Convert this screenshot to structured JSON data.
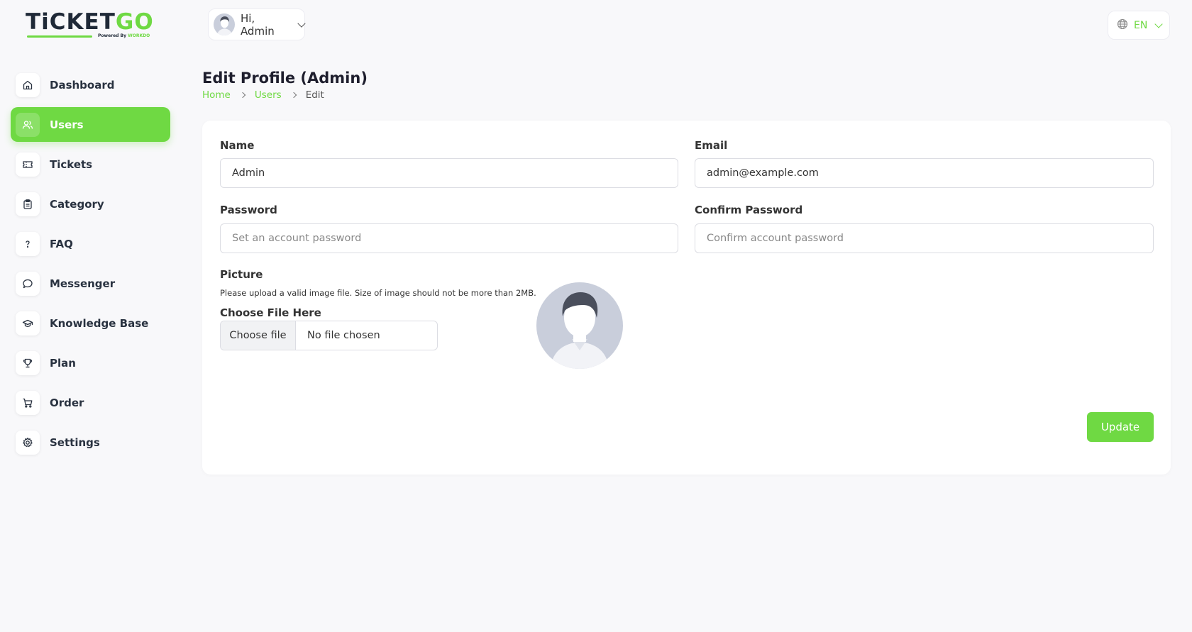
{
  "brand": {
    "logo_main": "TiCKET",
    "logo_accent": "GO",
    "powered_by": "Powered By",
    "powered_brand": "WORKDO"
  },
  "header": {
    "greeting": "Hi, Admin",
    "language": "EN"
  },
  "sidebar": {
    "items": [
      {
        "label": "Dashboard",
        "icon": "home-icon",
        "active": false
      },
      {
        "label": "Users",
        "icon": "users-icon",
        "active": true
      },
      {
        "label": "Tickets",
        "icon": "ticket-icon",
        "active": false
      },
      {
        "label": "Category",
        "icon": "clipboard-icon",
        "active": false
      },
      {
        "label": "FAQ",
        "icon": "question-icon",
        "active": false
      },
      {
        "label": "Messenger",
        "icon": "chat-icon",
        "active": false
      },
      {
        "label": "Knowledge Base",
        "icon": "school-icon",
        "active": false
      },
      {
        "label": "Plan",
        "icon": "trophy-icon",
        "active": false
      },
      {
        "label": "Order",
        "icon": "cart-icon",
        "active": false
      },
      {
        "label": "Settings",
        "icon": "gear-icon",
        "active": false
      }
    ]
  },
  "page": {
    "title": "Edit Profile (Admin)",
    "breadcrumb": [
      "Home",
      "Users",
      "Edit"
    ]
  },
  "form": {
    "name_label": "Name",
    "name_value": "Admin",
    "email_label": "Email",
    "email_value": "admin@example.com",
    "password_label": "Password",
    "password_placeholder": "Set an account password",
    "confirm_label": "Confirm Password",
    "confirm_placeholder": "Confirm account password",
    "picture_label": "Picture",
    "picture_hint": "Please upload a valid image file. Size of image should not be more than 2MB.",
    "choose_file_label": "Choose File Here",
    "choose_file_button": "Choose file",
    "file_status": "No file chosen",
    "update_button": "Update"
  },
  "colors": {
    "accent": "#6fd943",
    "background": "#f8f8fa",
    "avatar_bg": "#c9cedb"
  }
}
